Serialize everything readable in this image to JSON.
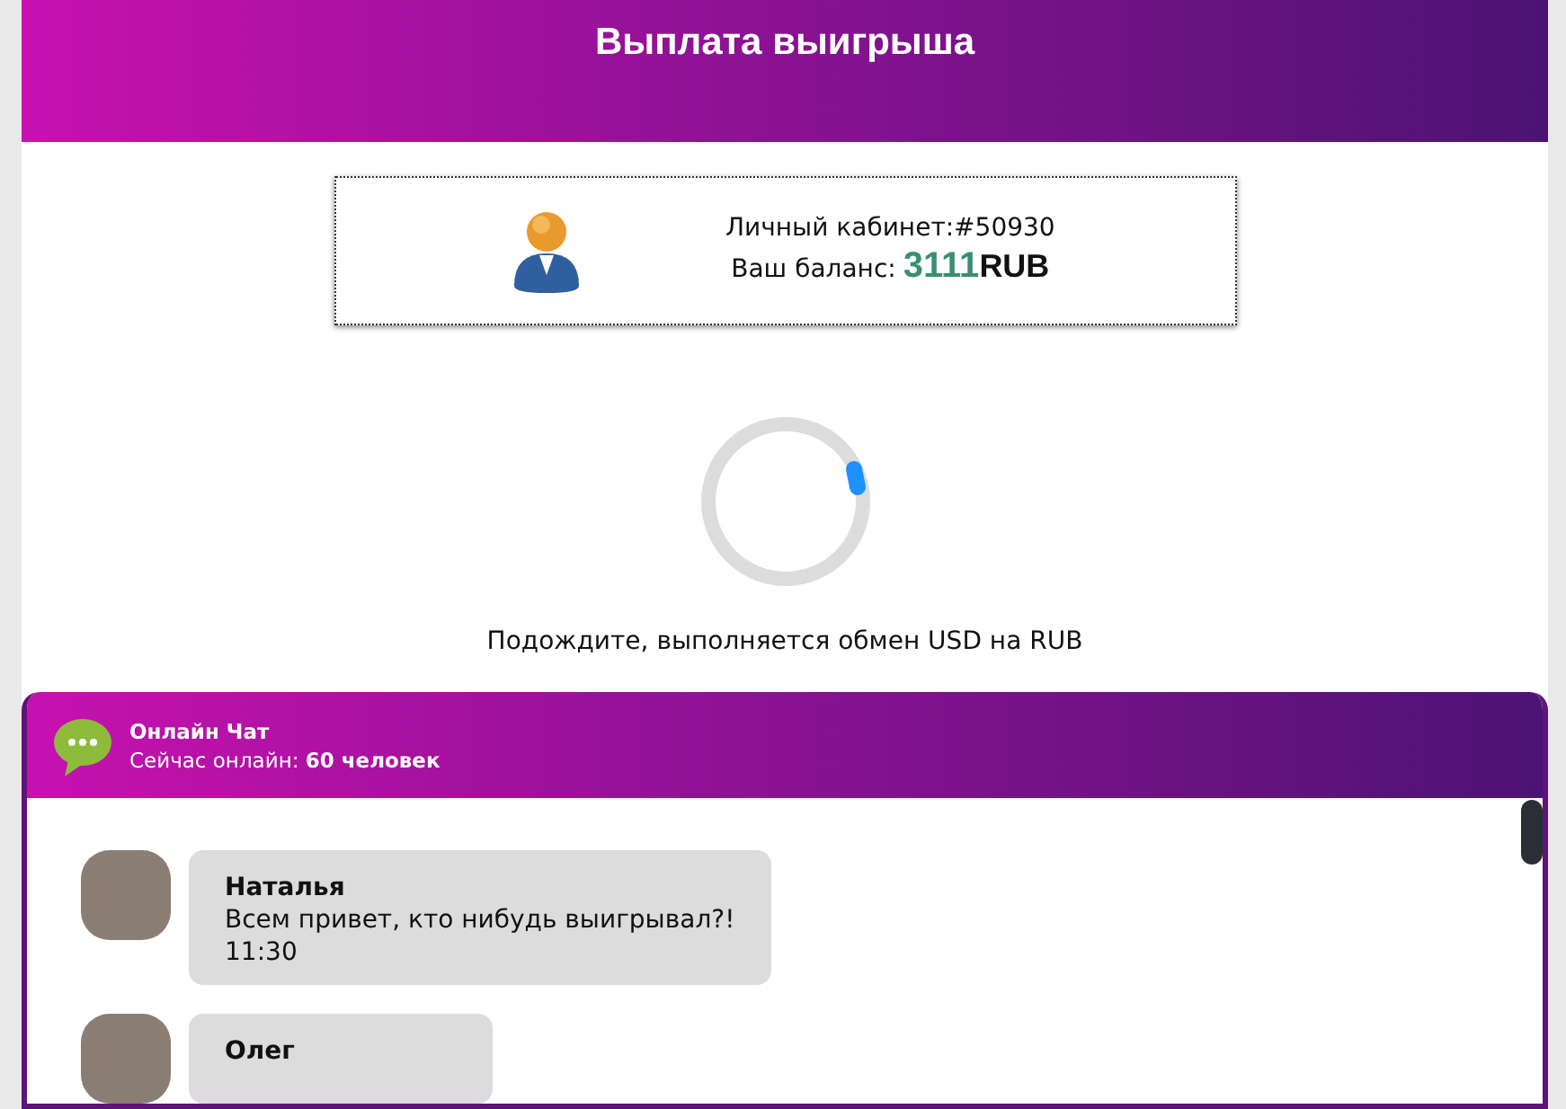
{
  "header": {
    "title": "Выплата выигрыша"
  },
  "account": {
    "cabinet": "Личный кабинет:#50930",
    "balance_label": "Ваш баланс:",
    "balance_amount": "3111",
    "currency": "RUB"
  },
  "status": {
    "message": "Подождите, выполняется обмен USD на RUB"
  },
  "chat": {
    "title": "Онлайн Чат",
    "online": "Сейчас онлайн: **60 человек**",
    "messages": [
      {
        "author": "Наталья",
        "text": "Всем привет, кто нибудь выигрывал?!",
        "time": "11:30"
      },
      {
        "author": "Олег"
      }
    ]
  }
}
